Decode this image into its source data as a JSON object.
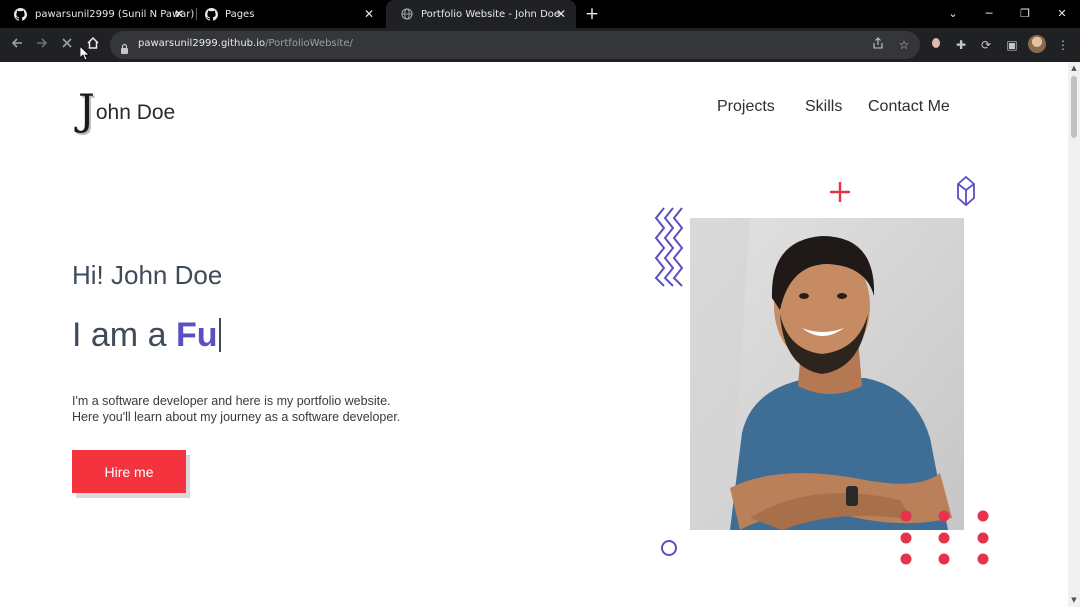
{
  "browser": {
    "tabs": [
      {
        "title": "pawarsunil2999 (Sunil N Pawar)",
        "icon": "github-icon",
        "active": false
      },
      {
        "title": "Pages",
        "icon": "github-icon",
        "active": false
      },
      {
        "title": "Portfolio Website - John Doe",
        "icon": "globe-icon",
        "active": true
      }
    ],
    "url": {
      "host": "pawarsunil2999.github.io",
      "path": "/PortfolioWebsite/"
    }
  },
  "site": {
    "logo": {
      "initial": "J",
      "rest": "ohn Doe"
    },
    "nav": [
      "Projects",
      "Skills",
      "Contact Me"
    ],
    "hero": {
      "greeting": "Hi! John Doe",
      "intro_prefix": "I am a ",
      "typed_text": "Fu",
      "description_line1": "I'm a software developer and here is my portfolio website.",
      "description_line2": "Here you'll learn about my journey as a software developer.",
      "cta_label": "Hire me"
    }
  },
  "colors": {
    "accent": "#5b4fc4",
    "cta": "#f3343f",
    "dots": "#e5334b",
    "text": "#3f4a5a"
  }
}
